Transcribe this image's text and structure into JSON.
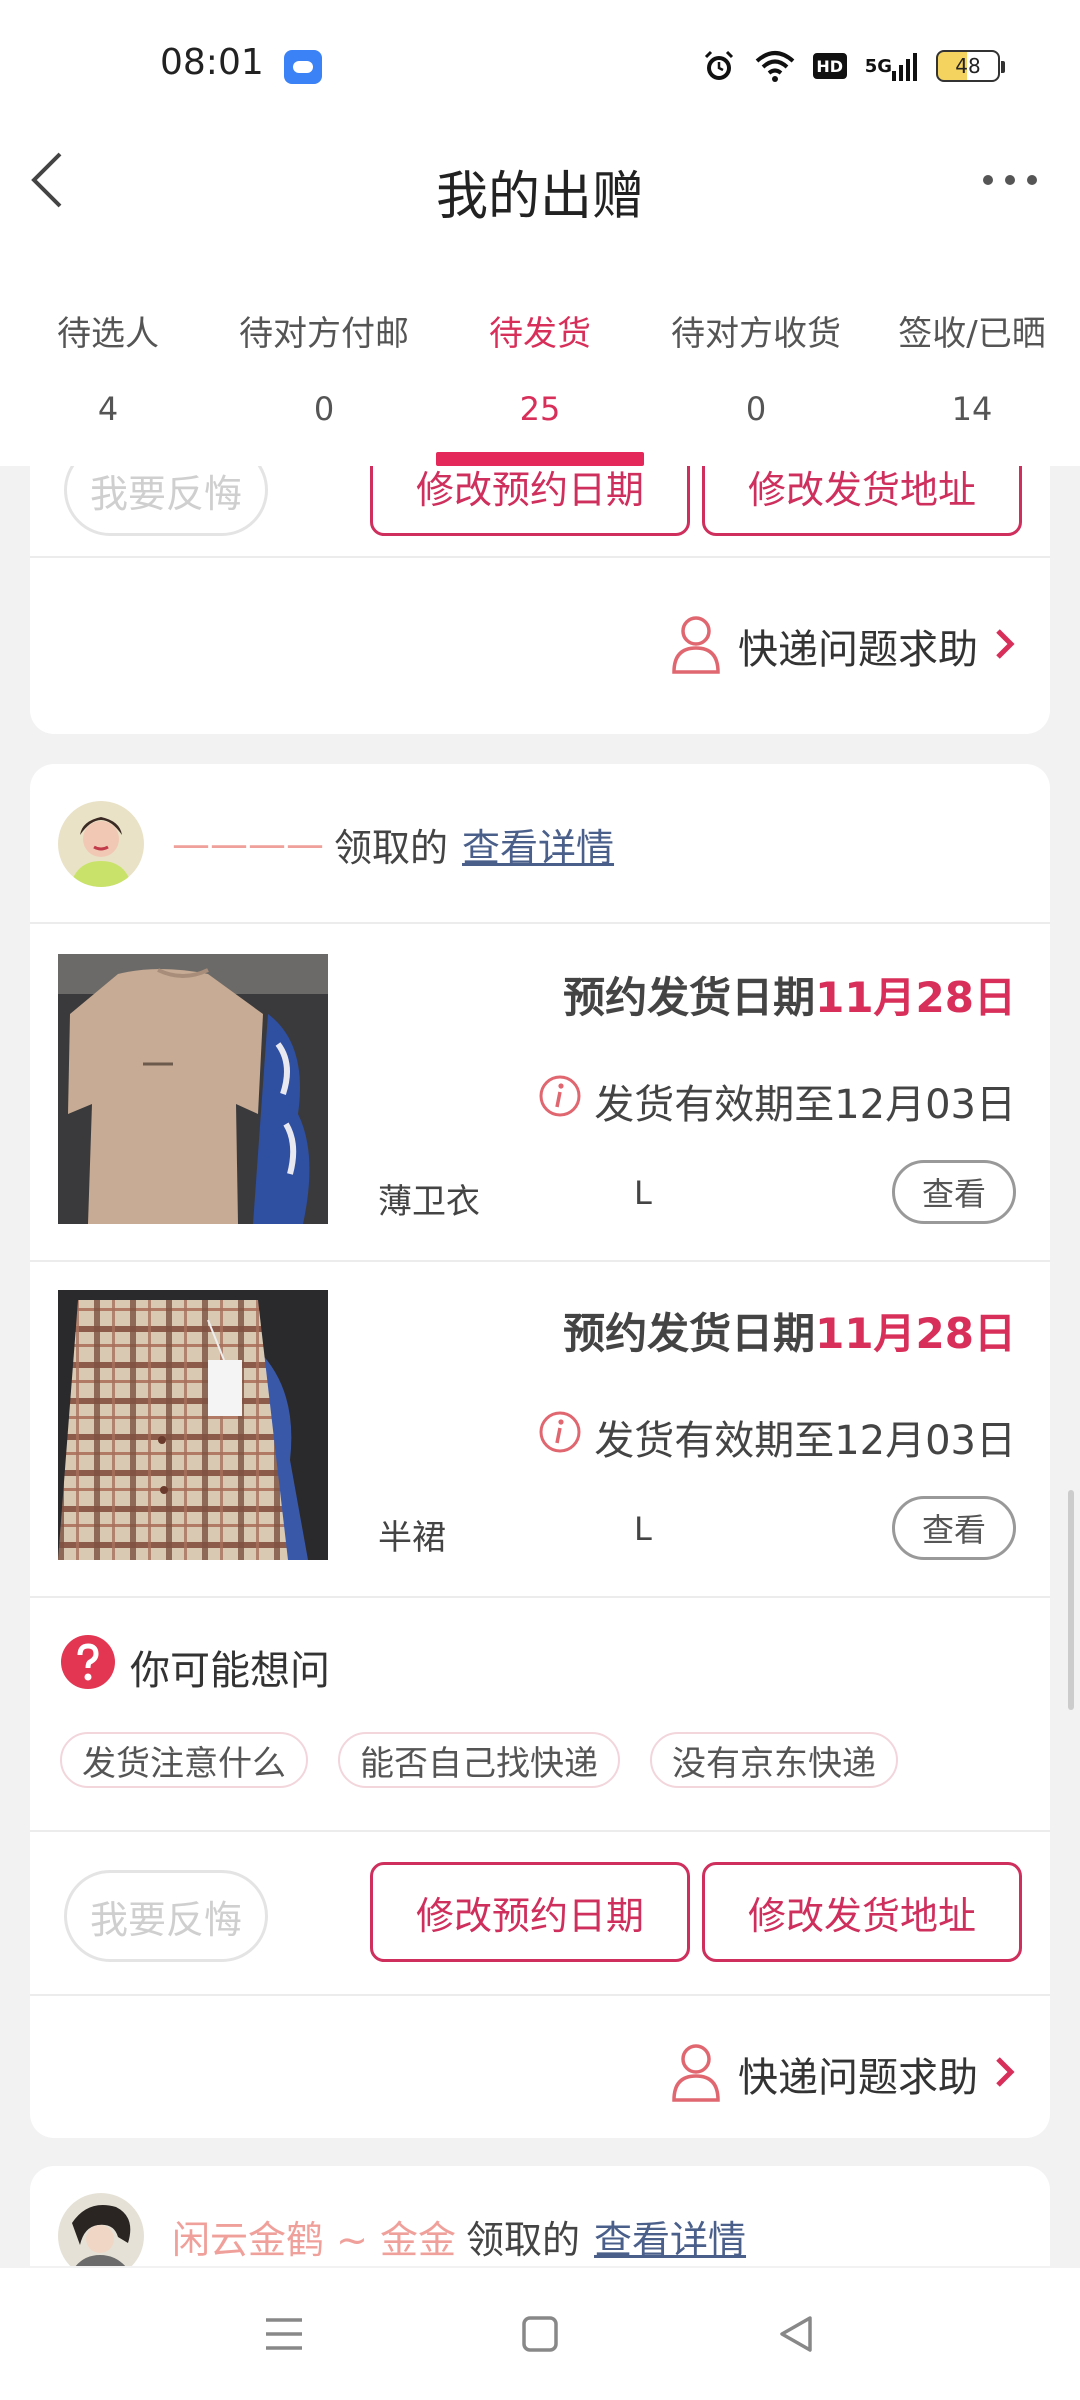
{
  "status_bar": {
    "time": "08:01",
    "battery": "48",
    "icons": [
      "app-notification-icon",
      "alarm-icon",
      "wifi-icon",
      "hd-icon",
      "5g-signal-icon",
      "battery-icon"
    ],
    "hd_label": "HD",
    "network_label": "5G"
  },
  "header": {
    "title": "我的出赠"
  },
  "tabs": [
    {
      "label": "待选人",
      "count": "4"
    },
    {
      "label": "待对方付邮",
      "count": "0"
    },
    {
      "label": "待发货",
      "count": "25",
      "active": true
    },
    {
      "label": "待对方收货",
      "count": "0"
    },
    {
      "label": "签收/已晒",
      "count": "14"
    }
  ],
  "colors": {
    "accent": "#d82f5a",
    "accent_border": "#cf2f5d",
    "link": "#4b5f8b",
    "username": "#f0a09a"
  },
  "card1": {
    "regret_label": "我要反悔",
    "change_date_label": "修改预约日期",
    "change_address_label": "修改发货地址",
    "help_label": "快递问题求助"
  },
  "card2": {
    "user": {
      "name": "————",
      "claimed": "领取的",
      "detail_link": "查看详情"
    },
    "items": [
      {
        "date_prefix": "预约发货日期",
        "date_value": "11月28日",
        "valid_until": "发货有效期至12月03日",
        "name": "薄卫衣",
        "size": "L",
        "view_label": "查看"
      },
      {
        "date_prefix": "预约发货日期",
        "date_value": "11月28日",
        "valid_until": "发货有效期至12月03日",
        "name": "半裙",
        "size": "L",
        "view_label": "查看"
      }
    ],
    "faq": {
      "title": "你可能想问",
      "chips": [
        "发货注意什么",
        "能否自己找快递",
        "没有京东快递"
      ]
    },
    "regret_label": "我要反悔",
    "change_date_label": "修改预约日期",
    "change_address_label": "修改发货地址",
    "help_label": "快递问题求助"
  },
  "card3": {
    "user": {
      "name": "闲云金鹤 ~ 金金",
      "claimed": "领取的",
      "detail_link": "查看详情"
    }
  },
  "navbar": {
    "icons": [
      "menu-icon",
      "home-square-icon",
      "back-triangle-icon"
    ]
  }
}
